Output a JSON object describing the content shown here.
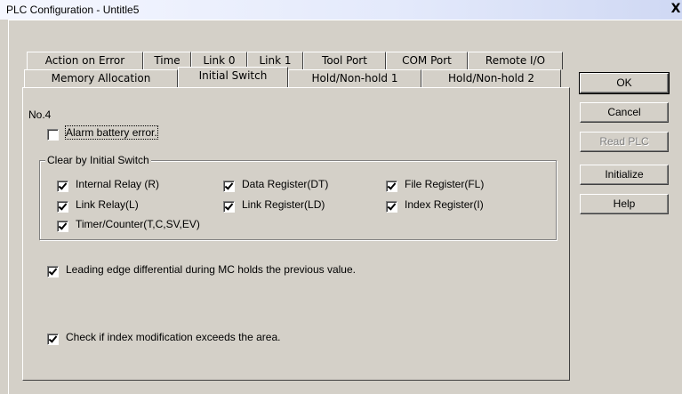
{
  "window": {
    "title": "PLC Configuration - Untitle5",
    "close_label": "X"
  },
  "tabs_row1": [
    {
      "label": "Action on Error"
    },
    {
      "label": "Time"
    },
    {
      "label": "Link 0"
    },
    {
      "label": "Link 1"
    },
    {
      "label": "Tool Port"
    },
    {
      "label": "COM Port"
    },
    {
      "label": "Remote I/O"
    }
  ],
  "tabs_row2": [
    {
      "label": "Memory Allocation"
    },
    {
      "label": "Initial Switch",
      "active": true
    },
    {
      "label": "Hold/Non-hold 1"
    },
    {
      "label": "Hold/Non-hold 2"
    }
  ],
  "panel": {
    "number_label": "No.4",
    "alarm_battery": {
      "label": "Alarm battery error.",
      "checked": false
    },
    "group_title": "Clear by Initial Switch",
    "clear_items": [
      {
        "label": "Internal Relay (R)",
        "checked": true
      },
      {
        "label": "Data Register(DT)",
        "checked": true
      },
      {
        "label": "File Register(FL)",
        "checked": true
      },
      {
        "label": "Link Relay(L)",
        "checked": true
      },
      {
        "label": "Link Register(LD)",
        "checked": true
      },
      {
        "label": "Index Register(I)",
        "checked": true
      },
      {
        "label": "Timer/Counter(T,C,SV,EV)",
        "checked": true
      }
    ],
    "leading_edge": {
      "label": "Leading edge differential during MC holds the previous value.",
      "checked": true
    },
    "check_index": {
      "label": "Check if index modification exceeds the area.",
      "checked": true
    }
  },
  "buttons": {
    "ok": "OK",
    "cancel": "Cancel",
    "read_plc": "Read PLC",
    "initialize": "Initialize",
    "help": "Help"
  }
}
